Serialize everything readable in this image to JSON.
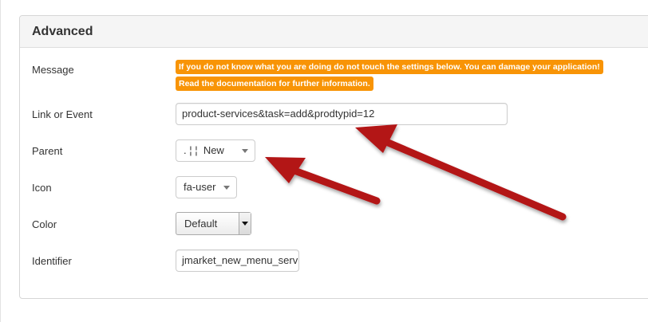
{
  "panel": {
    "title": "Advanced"
  },
  "message": {
    "label": "Message",
    "warning_line1": "If you do not know what you are doing do not touch the settings below. You can damage your application!",
    "warning_line2": "Read the documentation for further information."
  },
  "link_or_event": {
    "label": "Link or Event",
    "value": "product-services&task=add&prodtypid=12"
  },
  "parent": {
    "label": "Parent",
    "value": ". ¦ ¦  New"
  },
  "icon": {
    "label": "Icon",
    "value": "fa-user"
  },
  "color": {
    "label": "Color",
    "value": "Default"
  },
  "identifier": {
    "label": "Identifier",
    "value": "jmarket_new_menu_serv"
  },
  "colors": {
    "warning": "#f89406",
    "arrow": "#b31217"
  }
}
